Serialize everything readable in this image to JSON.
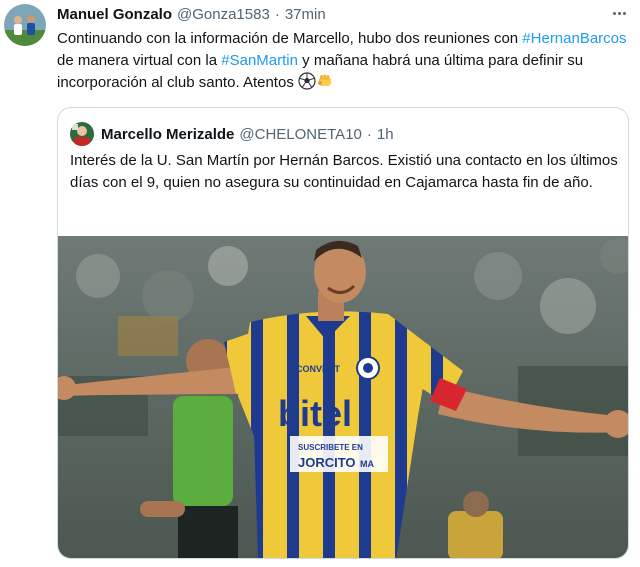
{
  "tweet": {
    "author_name": "Manuel Gonzalo",
    "author_handle": "@Gonza1583",
    "separator": "·",
    "time": "37min",
    "text_1": "Continuando con la información de Marcello, hubo dos reuniones con ",
    "hashtag_1": "#HernanBarcos",
    "text_2": " de manera virtual con la ",
    "hashtag_2": "#SanMartin",
    "text_3": " y mañana habrá una última para definir su incorporación al club santo. Atentos ",
    "emojis": [
      "soccer-ball",
      "punch"
    ]
  },
  "quote": {
    "author_name": "Marcello Merizalde",
    "author_handle": "@CHELONETA10",
    "separator": "·",
    "time": "1h",
    "text": "Interés de la U. San Martín por Hernán Barcos. Existió una contacto en los últimos días con el 9, quien no asegura su continuidad en Cajamarca hasta fin de año.",
    "media": {
      "description": "Football player in yellow and blue striped jersey celebrating with arms outstretched",
      "jersey_sponsor": "bitel",
      "jersey_kit_brand": "CONVERT",
      "jersey_sleeve_text": "convert",
      "jersey_ad_line1": "SUSCRIBETE EN",
      "jersey_ad_line2": "JORCITO",
      "jersey_ad_line3": "MA",
      "vertical_text": "CONVERT"
    }
  },
  "colors": {
    "link": "#1d9bf0",
    "text": "#0f1419",
    "secondary": "#536471",
    "border": "#cfd9de",
    "jersey_yellow": "#f0c93a",
    "jersey_blue": "#1f3b8f",
    "armband": "#d8262e"
  }
}
